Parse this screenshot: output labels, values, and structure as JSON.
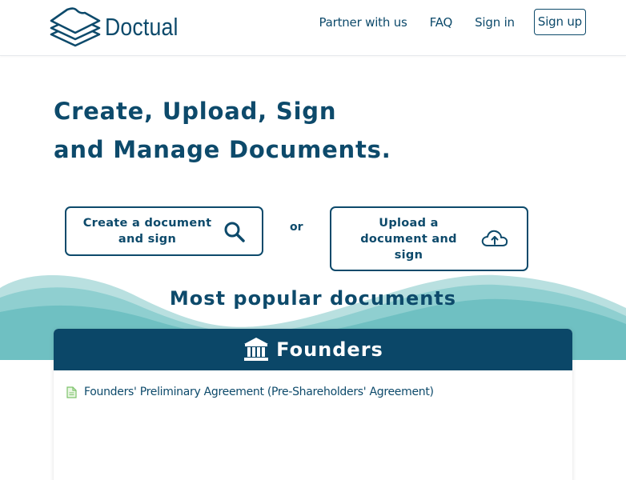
{
  "brand": {
    "name": "Doctual"
  },
  "nav": {
    "items": [
      {
        "label": "Partner with us"
      },
      {
        "label": "FAQ"
      },
      {
        "label": "Sign in"
      },
      {
        "label": "Sign up"
      }
    ]
  },
  "hero": {
    "title_line1": "Create, Upload, Sign",
    "title_line2": "and Manage Documents."
  },
  "actions": {
    "create_label": "Create a document and sign",
    "create_icon": "search-icon",
    "or_label": "or",
    "upload_label": "Upload a document and sign",
    "upload_icon": "cloud-upload-icon"
  },
  "popular": {
    "title": "Most popular documents",
    "category": {
      "name": "Founders",
      "icon": "bank-icon",
      "documents": [
        {
          "label": "Founders' Preliminary Agreement (Pre-Shareholders' Agreement)",
          "icon": "document-icon"
        }
      ]
    }
  },
  "colors": {
    "primary": "#0d4a6b",
    "header_bar": "#0b4768",
    "wave_light": "#b9e0e0",
    "wave_mid": "#8fcfd0",
    "wave_dark": "#6fc0c2",
    "doc_icon": "#7cc36a"
  }
}
